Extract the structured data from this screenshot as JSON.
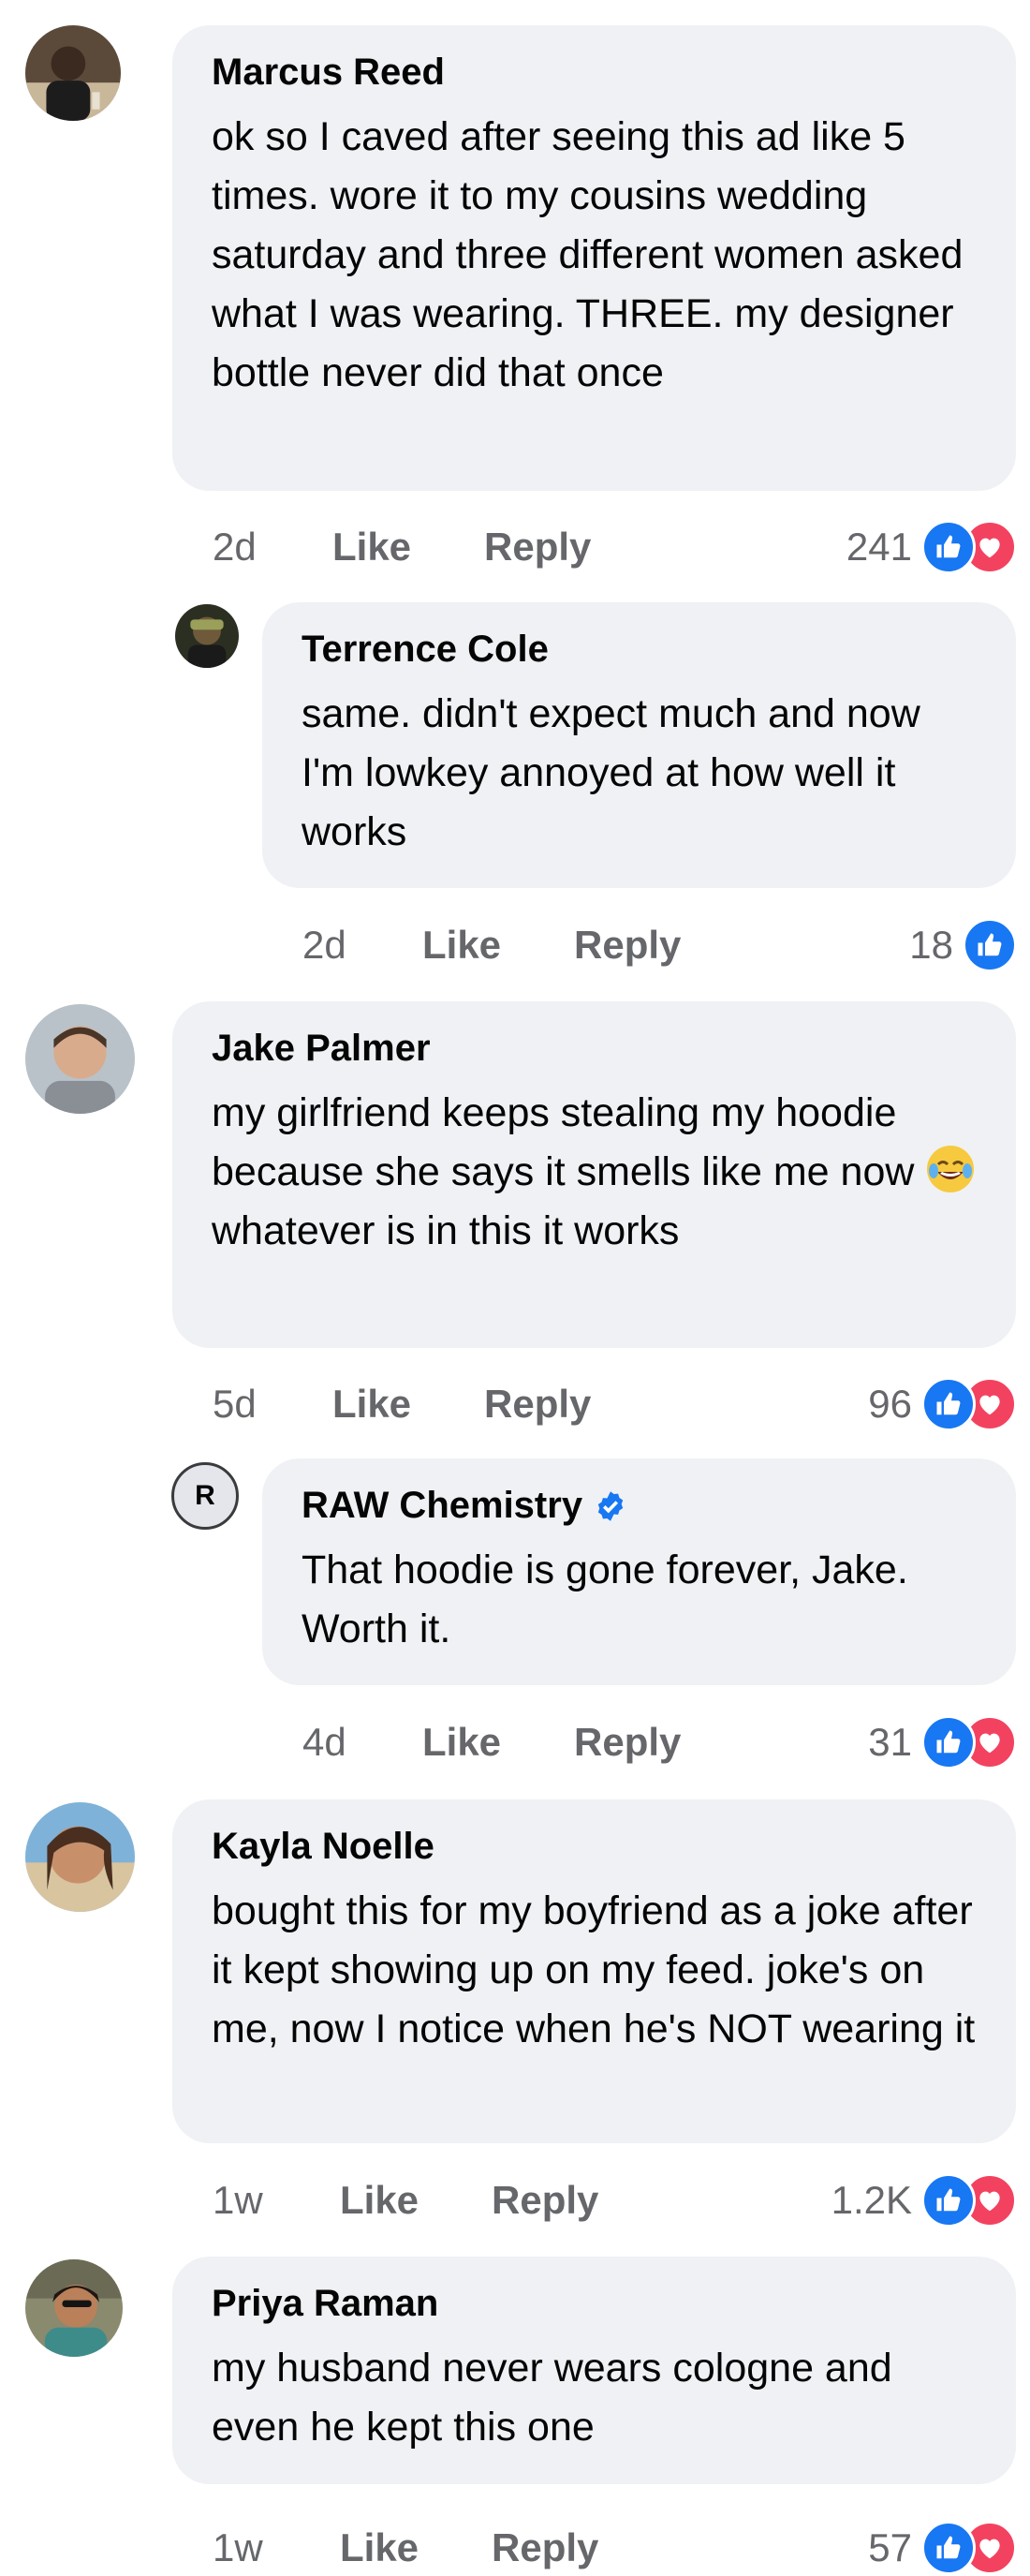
{
  "comments": [
    {
      "author": "Marcus Reed",
      "text": "ok so I caved after seeing this ad like 5 times. wore it to my cousins wedding saturday and three different women asked what I was wearing. THREE. my designer bottle never did that once",
      "time": "2d",
      "like_label": "Like",
      "reply_label": "Reply",
      "reaction_count": "241",
      "reactions": [
        "like-icon",
        "love-icon"
      ]
    },
    {
      "author": "Terrence Cole",
      "text": "same. didn't expect much and now I'm lowkey annoyed at how well it works",
      "time": "2d",
      "like_label": "Like",
      "reply_label": "Reply",
      "reaction_count": "18",
      "reactions": [
        "like-icon"
      ]
    },
    {
      "author": "Jake Palmer",
      "text_before_emoji": "my girlfriend keeps stealing my hoodie because she says it smells like me now",
      "text_after_emoji": "whatever is in this it works",
      "emoji": "face-with-tears-of-joy",
      "time": "5d",
      "like_label": "Like",
      "reply_label": "Reply",
      "reaction_count": "96",
      "reactions": [
        "like-icon",
        "love-icon"
      ]
    },
    {
      "author": "RAW Chemistry",
      "avatar_letter": "R",
      "verified": true,
      "text": "That hoodie is gone forever, Jake. Worth it.",
      "time": "4d",
      "like_label": "Like",
      "reply_label": "Reply",
      "reaction_count": "31",
      "reactions": [
        "like-icon",
        "love-icon"
      ]
    },
    {
      "author": "Kayla Noelle",
      "text": "bought this for my boyfriend as a joke after it kept showing up on my feed. joke's on me, now I notice when he's NOT wearing it",
      "time": "1w",
      "like_label": "Like",
      "reply_label": "Reply",
      "reaction_count": "1.2K",
      "reactions": [
        "like-icon",
        "love-icon"
      ]
    },
    {
      "author": "Priya Raman",
      "text": "my husband never wears cologne and even he kept this one",
      "time": "1w",
      "like_label": "Like",
      "reply_label": "Reply",
      "reaction_count": "57",
      "reactions": [
        "like-icon",
        "love-icon"
      ]
    }
  ],
  "colors": {
    "bubble": "#eff1f4",
    "meta_text": "#65676b",
    "like_blue": "#1877f2",
    "love_red": "#f3425f"
  }
}
